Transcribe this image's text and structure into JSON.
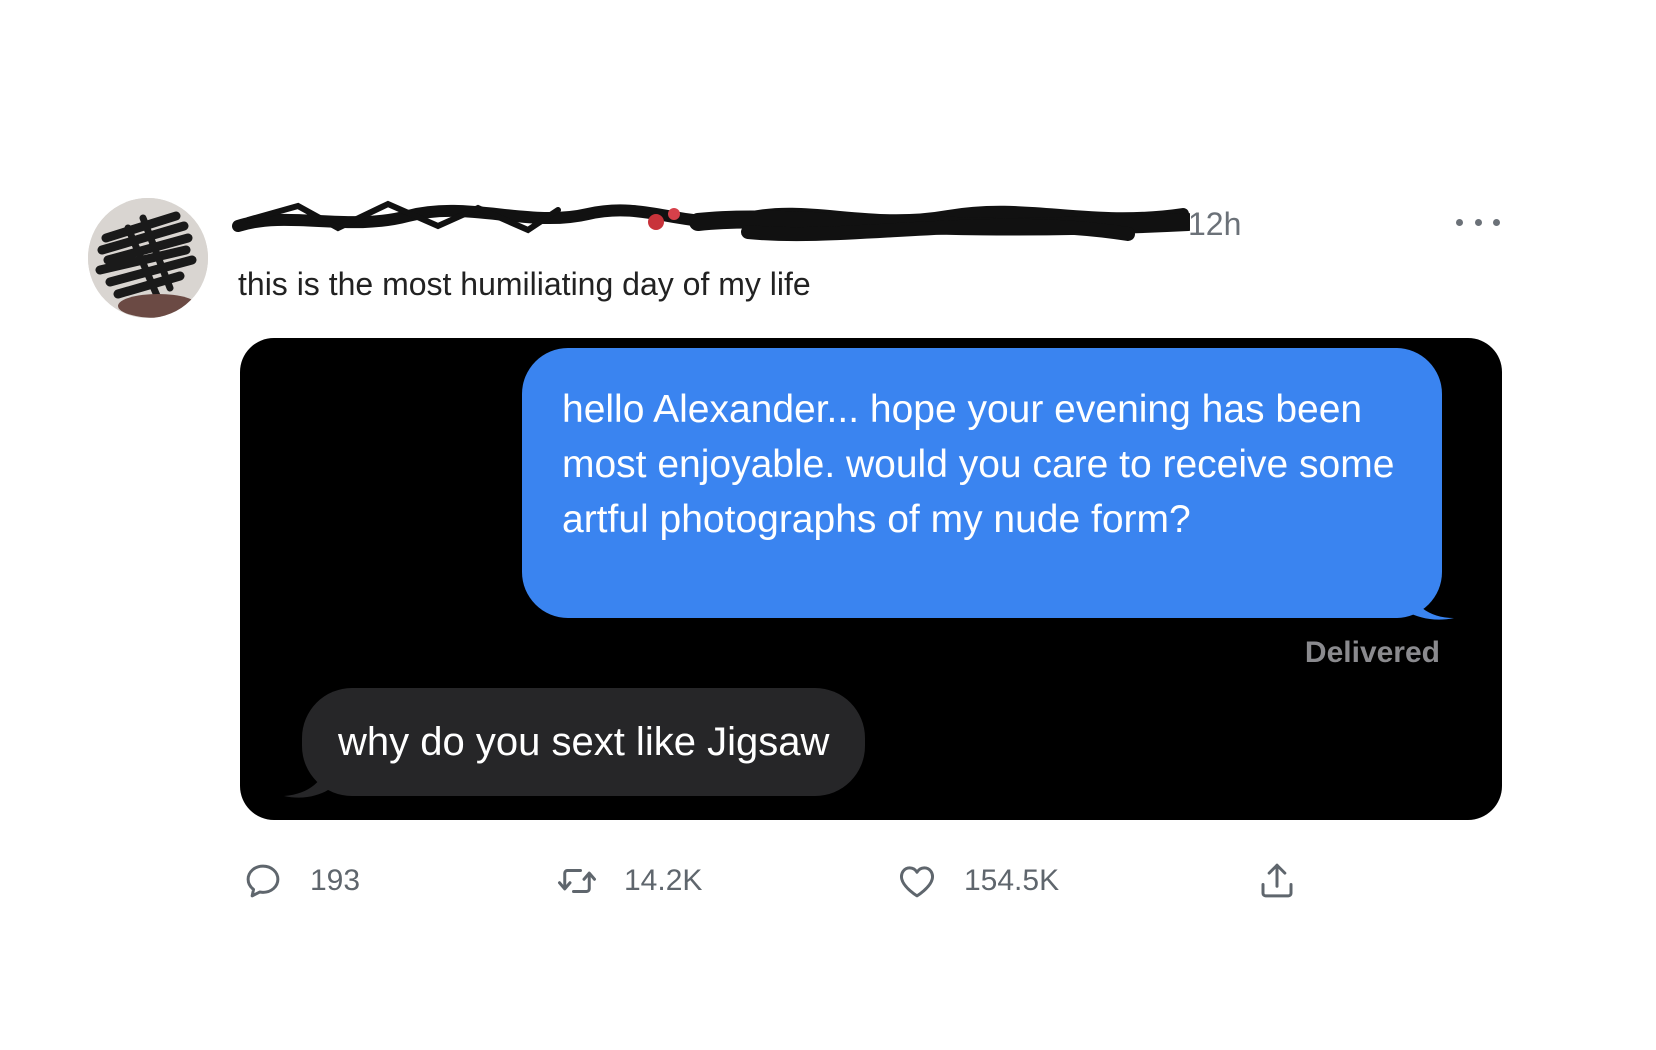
{
  "tweet": {
    "author_redacted": true,
    "timestamp": "12h",
    "text": "this is the most humiliating day of my life"
  },
  "screenshot": {
    "outgoing_message": "hello Alexander... hope your evening has been most enjoyable. would you care to receive some artful photographs of my nude form?",
    "delivered_label": "Delivered",
    "incoming_message": "why do you sext like Jigsaw"
  },
  "actions": {
    "reply_count": "193",
    "retweet_count": "14.2K",
    "like_count": "154.5K"
  },
  "icons": {
    "reply": "reply-icon",
    "retweet": "retweet-icon",
    "like": "heart-icon",
    "share": "share-icon",
    "more": "more-icon"
  },
  "colors": {
    "imessage_blue": "#3a84f0",
    "imessage_gray": "#262628",
    "screenshot_background": "#000000",
    "muted_text": "#6b7178"
  }
}
